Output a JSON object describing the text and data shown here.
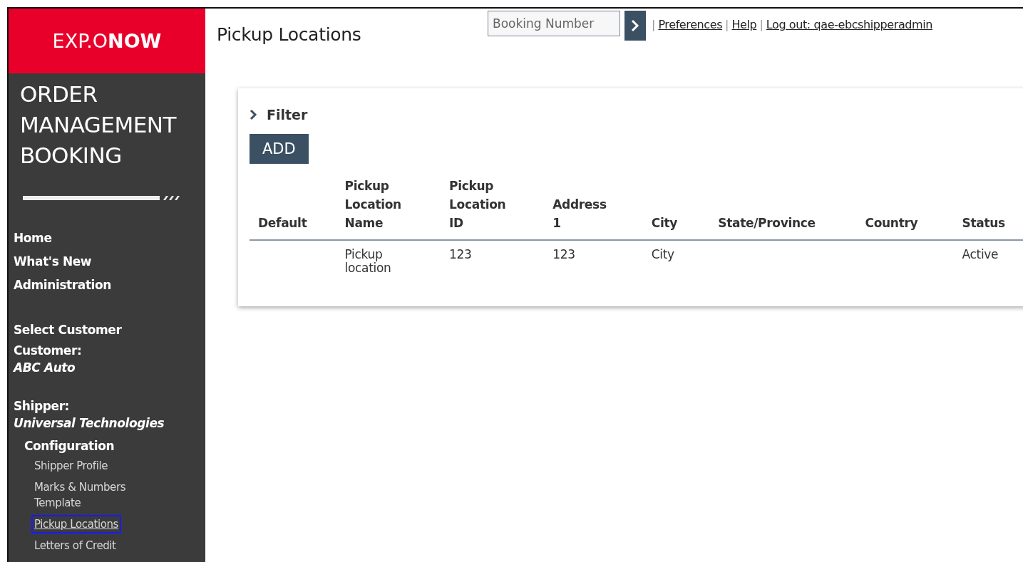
{
  "logo": "EXP.O**NOW**",
  "app_title": [
    "ORDER",
    "MANAGEMENT",
    "BOOKING"
  ],
  "sidebar": {
    "main_links": [
      "Home",
      "What's New",
      "Administration"
    ],
    "select_customer": "Select Customer",
    "customer": {
      "label": "Customer:",
      "value": "ABC Auto"
    },
    "shipper": {
      "label": "Shipper:",
      "value": "Universal Technologies"
    },
    "section": "Configuration",
    "items": [
      {
        "label": "Shipper Profile",
        "selected": false
      },
      {
        "label": "Marks & Numbers Template",
        "selected": false
      },
      {
        "label": "Pickup Locations",
        "selected": true
      },
      {
        "label": "Letters of Credit",
        "selected": false
      }
    ]
  },
  "page_title": "Pickup Locations",
  "search": {
    "placeholder": "Booking Number"
  },
  "top_links": [
    {
      "separator": "|",
      "label": "Preferences"
    },
    {
      "separator": "|",
      "label": "Help"
    },
    {
      "separator": "|",
      "label": "Log out: qae-ebcshipperadmin"
    }
  ],
  "filter": {
    "label": "Filter",
    "expanded": false
  },
  "add_button": "ADD",
  "table": {
    "columns": [
      "Default",
      "Pickup Location Name",
      "Pickup Location ID",
      "Address 1",
      "City",
      "State/Province",
      "Country",
      "Status"
    ],
    "rows": [
      [
        "",
        "Pickup location",
        "123",
        "123",
        "City",
        "",
        "",
        "Active"
      ]
    ]
  }
}
